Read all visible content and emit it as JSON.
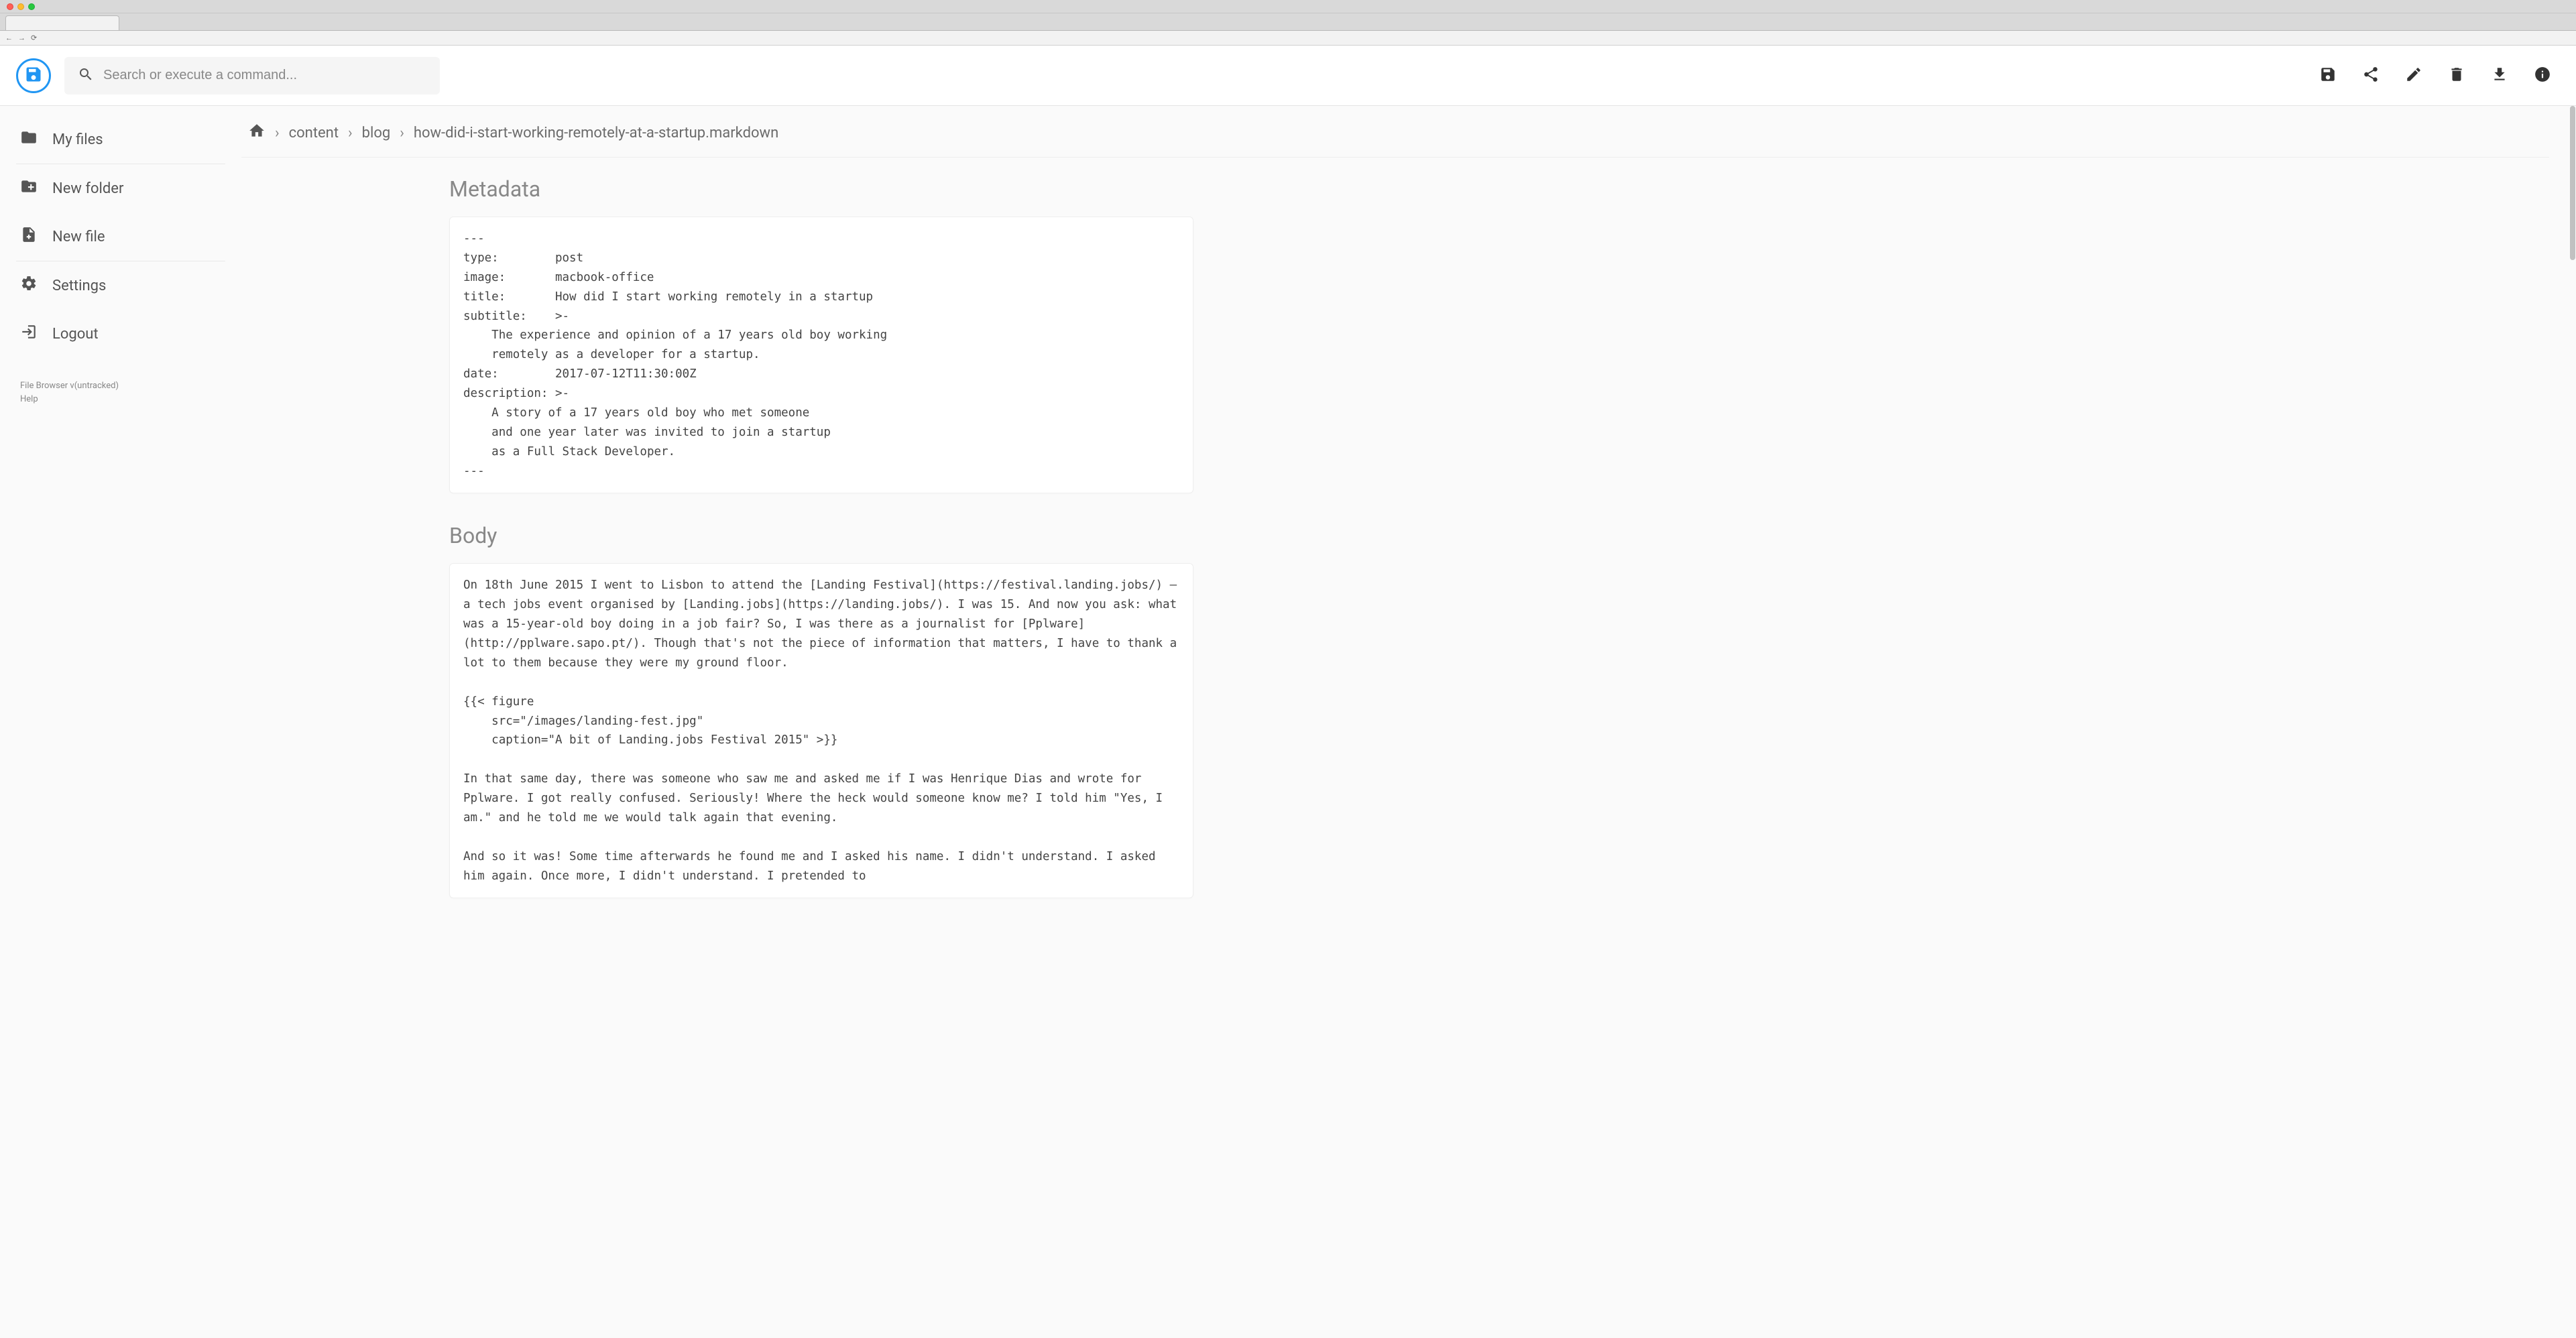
{
  "search": {
    "placeholder": "Search or execute a command..."
  },
  "sidebar": {
    "items": [
      {
        "label": "My files"
      },
      {
        "label": "New folder"
      },
      {
        "label": "New file"
      },
      {
        "label": "Settings"
      },
      {
        "label": "Logout"
      }
    ],
    "footer": {
      "version": "File Browser v(untracked)",
      "help": "Help"
    }
  },
  "breadcrumb": {
    "segments": [
      "content",
      "blog",
      "how-did-i-start-working-remotely-at-a-startup.markdown"
    ]
  },
  "editor": {
    "metadata_title": "Metadata",
    "metadata_text": "---\ntype:        post\nimage:       macbook-office\ntitle:       How did I start working remotely in a startup\nsubtitle:    >-\n    The experience and opinion of a 17 years old boy working\n    remotely as a developer for a startup.\ndate:        2017-07-12T11:30:00Z\ndescription: >-\n    A story of a 17 years old boy who met someone\n    and one year later was invited to join a startup\n    as a Full Stack Developer.\n---",
    "body_title": "Body",
    "body_text": "On 18th June 2015 I went to Lisbon to attend the [Landing Festival](https://festival.landing.jobs/) — a tech jobs event organised by [Landing.jobs](https://landing.jobs/). I was 15. And now you ask: what was a 15-year-old boy doing in a job fair? So, I was there as a journalist for [Pplware](http://pplware.sapo.pt/). Though that's not the piece of information that matters, I have to thank a lot to them because they were my ground floor.\n\n{{< figure\n    src=\"/images/landing-fest.jpg\"\n    caption=\"A bit of Landing.jobs Festival 2015\" >}}\n\nIn that same day, there was someone who saw me and asked me if I was Henrique Dias and wrote for Pplware. I got really confused. Seriously! Where the heck would someone know me? I told him \"Yes, I am.\" and he told me we would talk again that evening.\n\nAnd so it was! Some time afterwards he found me and I asked his name. I didn't understand. I asked him again. Once more, I didn't understand. I pretended to"
  }
}
